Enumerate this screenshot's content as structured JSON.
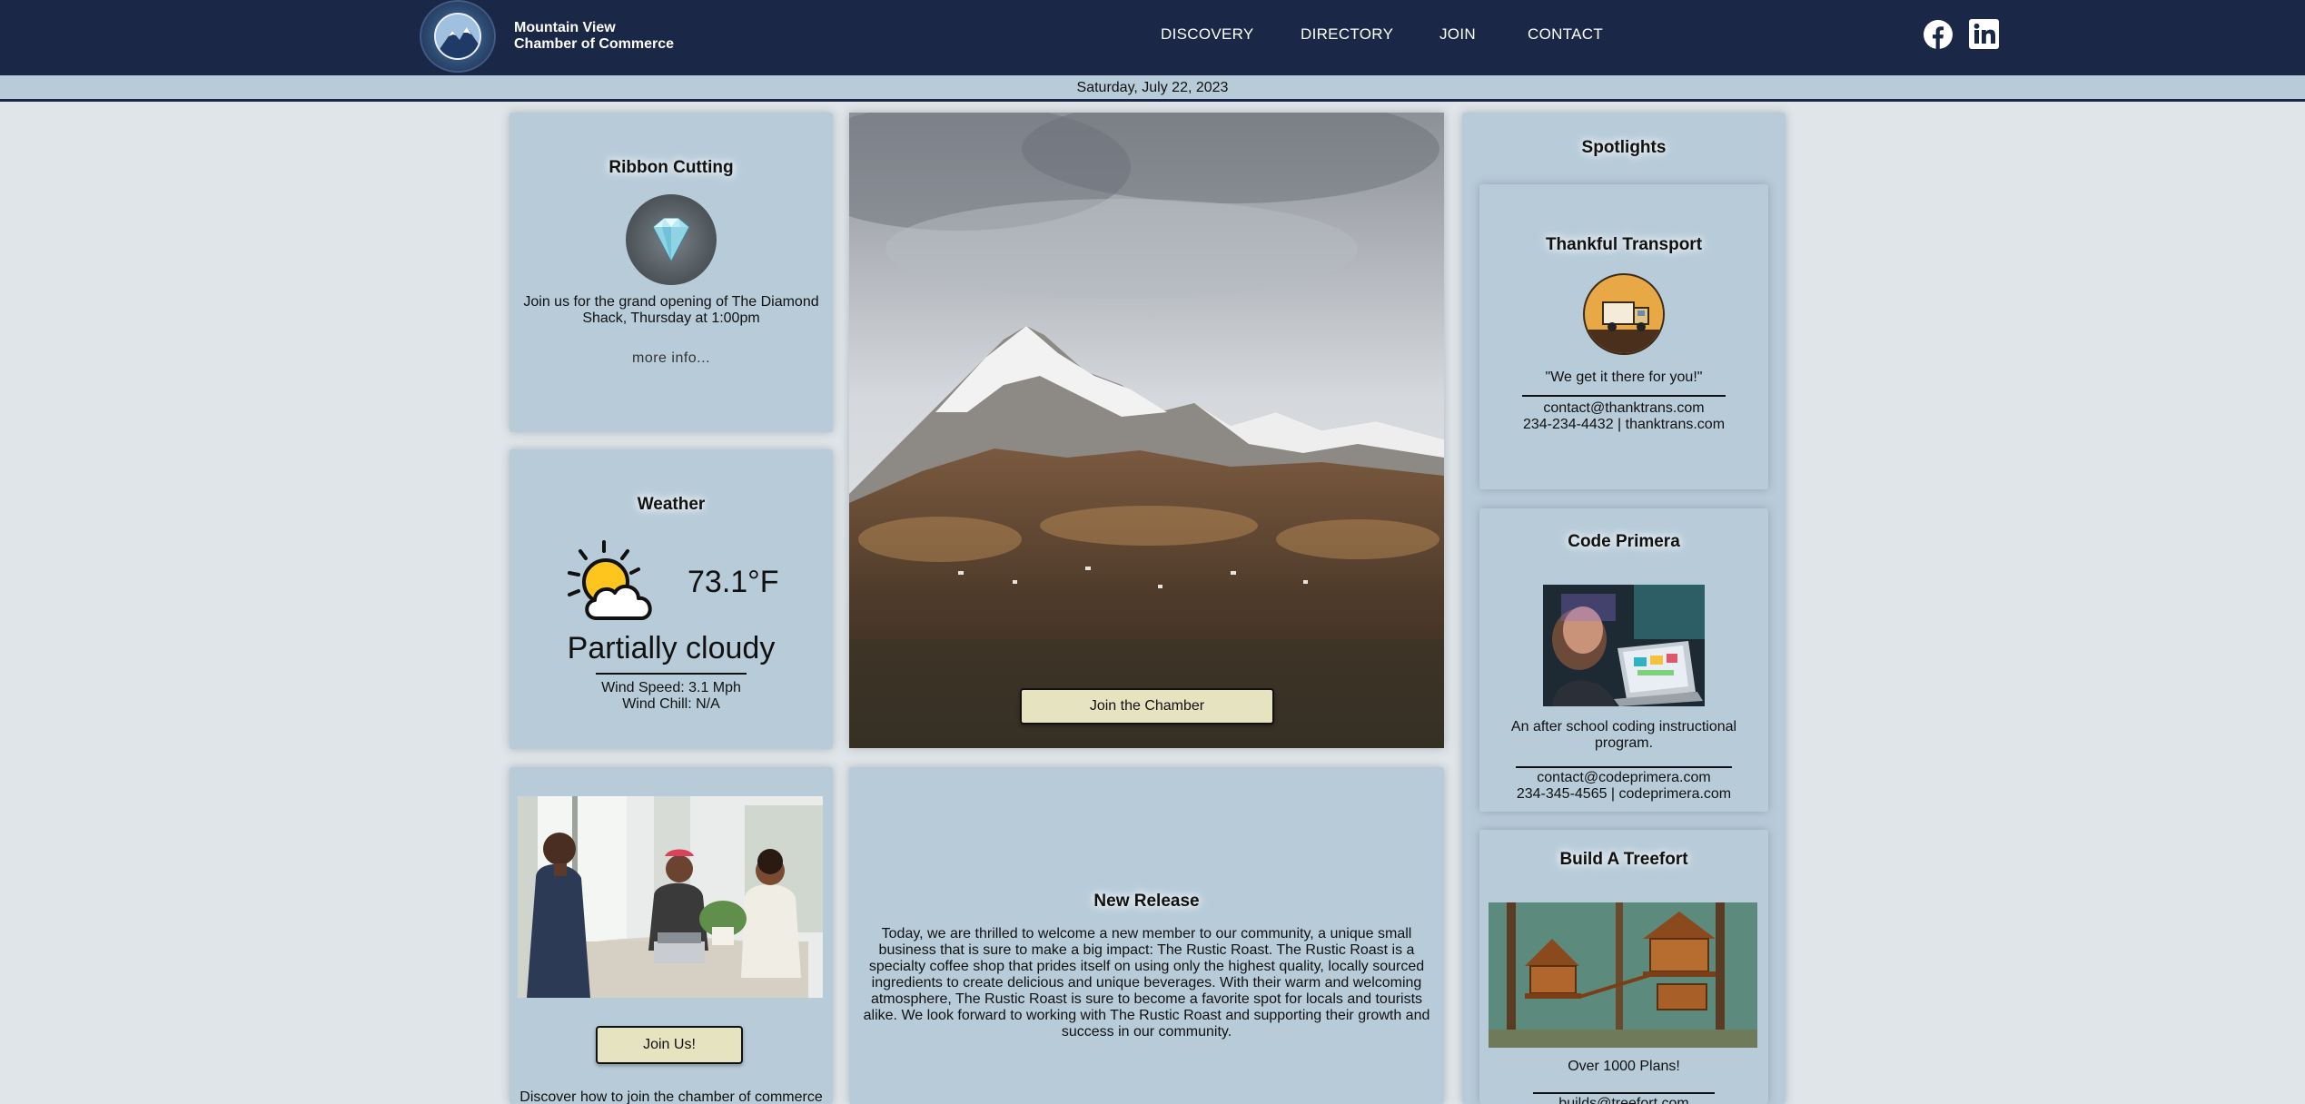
{
  "header": {
    "brand_line1": "Mountain View",
    "brand_line2": "Chamber of Commerce",
    "nav": [
      "DISCOVERY",
      "DIRECTORY",
      "JOIN",
      "CONTACT"
    ],
    "social": [
      "facebook-icon",
      "linkedin-icon"
    ]
  },
  "date": "Saturday, July 22, 2023",
  "ribbon": {
    "title": "Ribbon Cutting",
    "text": "Join us for the grand opening of The Diamond Shack, Thursday at 1:00pm",
    "more": "more info..."
  },
  "weather": {
    "title": "Weather",
    "temp": "73.1°F",
    "condition": "Partially cloudy",
    "wind_speed": "Wind Speed: 3.1 Mph",
    "wind_chill": "Wind Chill: N/A"
  },
  "hero": {
    "button": "Join the Chamber"
  },
  "join": {
    "button": "Join Us!",
    "text": "Discover how to join the chamber of commerce"
  },
  "release": {
    "title": "New Release",
    "text": "Today, we are thrilled to welcome a new member to our community, a unique small business that is sure to make a big impact: The Rustic Roast. The Rustic Roast is a specialty coffee shop that prides itself on using only the highest quality, locally sourced ingredients to create delicious and unique beverages. With their warm and welcoming atmosphere, The Rustic Roast is sure to become a favorite spot for locals and tourists alike. We look forward to working with The Rustic Roast and supporting their growth and success in our community."
  },
  "spotlights": {
    "title": "Spotlights",
    "items": [
      {
        "name": "Thankful Transport",
        "tagline": "\"We get it there for you!\"",
        "email": "contact@thanktrans.com",
        "contact": "234-234-4432 | thanktrans.com"
      },
      {
        "name": "Code Primera",
        "tagline": "An after school coding instructional program.",
        "email": "contact@codeprimera.com",
        "contact": "234-345-4565 | codeprimera.com"
      },
      {
        "name": "Build A Treefort",
        "tagline": "Over 1000 Plans!",
        "email": "builds@treefort.com"
      }
    ]
  },
  "colors": {
    "header_bg": "#1a2747",
    "card_bg": "#b7cbd9",
    "page_bg": "#dfe5e9",
    "button_bg": "#e5e3c0"
  }
}
